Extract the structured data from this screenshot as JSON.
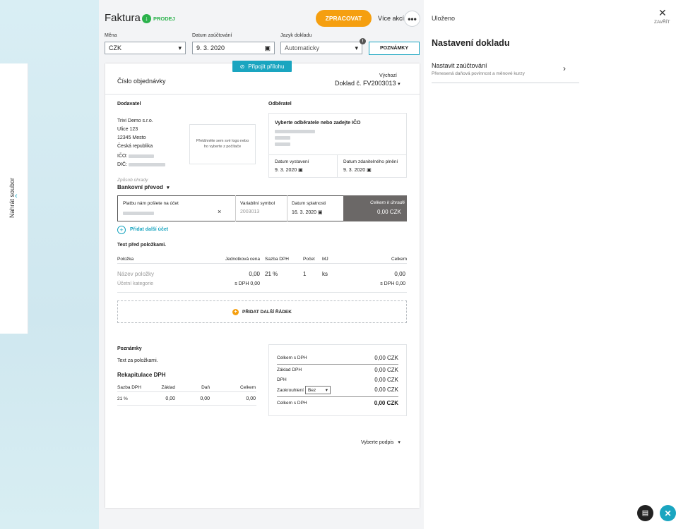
{
  "header": {
    "title": "Faktura",
    "type_label": "PRODEJ",
    "process_label": "ZPRACOVAT",
    "more_label": "Více akcí",
    "more_icon": "•••",
    "saved": "Uloženo",
    "close_label": "ZAVŘÍT"
  },
  "upload": {
    "label": "Nahrát soubor"
  },
  "fields": {
    "currency": {
      "label": "Měna",
      "value": "CZK"
    },
    "posting_date": {
      "label": "Datum zaúčtování",
      "value": "9. 3. 2020"
    },
    "language": {
      "label": "Jazyk dokladu",
      "value": "Automaticky"
    },
    "notes_button": "POZNÁMKY"
  },
  "attach_label": "Připojit přílohu",
  "doc": {
    "order_label": "Číslo objednávky",
    "series_label": "Výchozí",
    "doc_number": "Doklad č. FV2003013",
    "supplier": {
      "heading": "Dodavatel",
      "name": "Trivi Demo s.r.o.",
      "street": "Ulice 123",
      "city": "12345 Mesto",
      "country": "Česká republika",
      "ico_label": "IČO:",
      "dic_label": "DIČ:"
    },
    "logo_hint": "Přetáhněte sem své logo nebo ho vyberte z počítače",
    "customer": {
      "heading": "Odběratel",
      "hint": "Vyberte odběratele nebo zadejte IČO",
      "issue_label": "Datum vystavení",
      "issue_date": "9. 3. 2020",
      "tax_label": "Datum zdanitelného plnění",
      "tax_date": "9. 3. 2020"
    },
    "payment": {
      "method_label": "Způsob úhrady",
      "method": "Bankovní převod",
      "account_label": "Platbu nám pošlete na účet",
      "vs_label": "Variabilní symbol",
      "vs_value": "2003013",
      "due_label": "Datum splatnosti",
      "due_date": "16. 3. 2020",
      "total_label": "Celkem k úhradě",
      "total_value": "0,00 CZK",
      "add_account": "Přidat další účet"
    },
    "text_before": "Text před položkami.",
    "items": {
      "headers": [
        "Položka",
        "Jednotková cena",
        "Sazba DPH",
        "Počet",
        "MJ",
        "Celkem"
      ],
      "row": {
        "name": "Název položky",
        "category": "Účetní kategorie",
        "price": "0,00",
        "price_vat": "s DPH 0,00",
        "vat": "21 %",
        "qty": "1",
        "unit": "ks",
        "total": "0,00",
        "total_vat": "s DPH 0,00"
      },
      "add_row": "PŘIDAT DALŠÍ ŘÁDEK"
    },
    "notes": {
      "heading": "Poznámky",
      "text": "Text za položkami."
    },
    "recap": {
      "heading": "Rekapitulace DPH",
      "headers": [
        "Sazba DPH",
        "Základ",
        "Daň",
        "Celkem"
      ],
      "row": [
        "21 %",
        "0,00",
        "0,00",
        "0,00"
      ]
    },
    "summary": {
      "without_vat_label": "Celkem s DPH",
      "without_vat": "0,00 CZK",
      "base_label": "Základ DPH",
      "base": "0,00 CZK",
      "vat_label": "DPH",
      "vat": "0,00 CZK",
      "rounding_label": "Zaokrouhlení",
      "rounding_select": "Bez",
      "rounding": "0,00 CZK",
      "total_label": "Celkem s DPH",
      "total": "0,00 CZK"
    },
    "signature": "Vyberte podpis"
  },
  "right": {
    "heading": "Nastavení dokladu",
    "setting_title": "Nastavit zaúčtování",
    "setting_sub": "Přenesená daňová povinnost a měnové kurzy"
  },
  "colors": {
    "accent": "#1aa5c0",
    "orange": "#f59f10",
    "green": "#2bb24c"
  },
  "icons": [
    "download-arrow-icon",
    "more-dots-icon",
    "close-icon",
    "calendar-icon",
    "chevron-down-icon",
    "paperclip-icon",
    "plus-icon",
    "chevron-right-icon",
    "chat-icon",
    "help-icon"
  ]
}
